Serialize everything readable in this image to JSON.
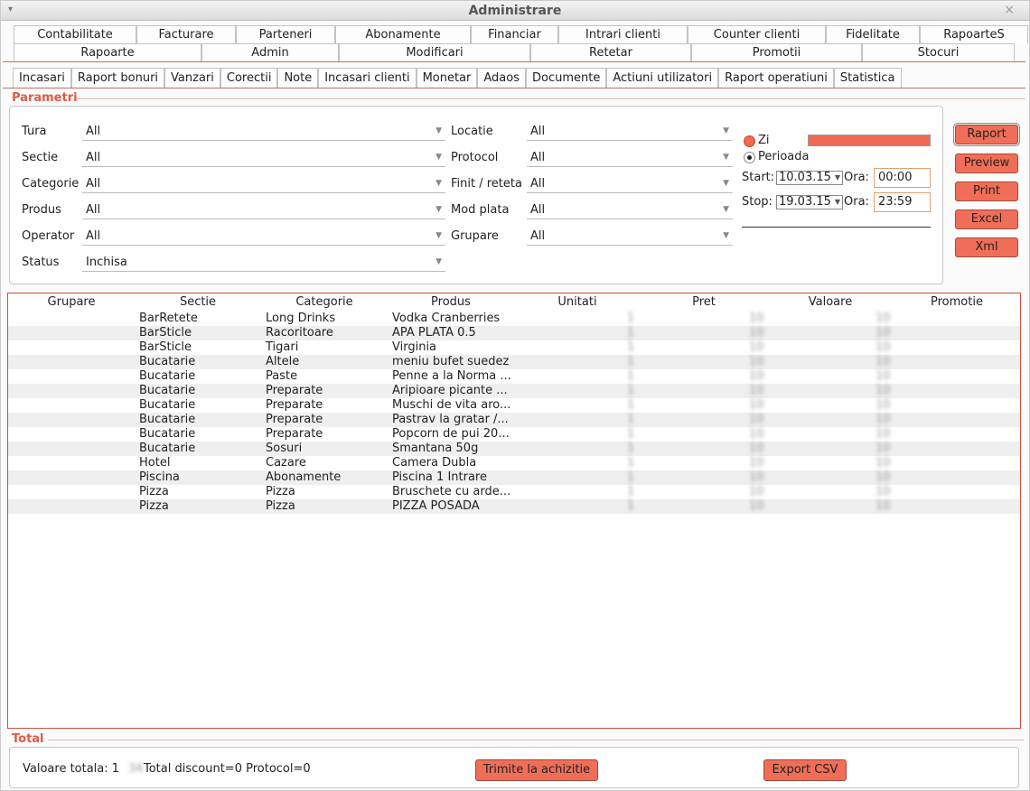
{
  "window": {
    "title": "Administrare",
    "close_glyph": "×",
    "menu_glyph": "▾"
  },
  "tabs_row1": [
    "Contabilitate",
    "Facturare",
    "Parteneri",
    "Abonamente",
    "Financiar",
    "Intrari clienti",
    "Counter clienti",
    "Fidelitate",
    "RapoarteS"
  ],
  "tabs_row2": [
    "Rapoarte",
    "Admin",
    "Modificari",
    "Retetar",
    "Promotii",
    "Stocuri"
  ],
  "subtabs": [
    "Incasari",
    "Raport bonuri",
    "Vanzari",
    "Corectii",
    "Note",
    "Incasari clienti",
    "Monetar",
    "Adaos",
    "Documente",
    "Actiuni utilizatori",
    "Raport operatiuni",
    "Statistica"
  ],
  "params": {
    "section_label": "Parametri",
    "left": [
      {
        "label": "Tura",
        "value": "All"
      },
      {
        "label": "Sectie",
        "value": "All"
      },
      {
        "label": "Categorie",
        "value": "All"
      },
      {
        "label": "Produs",
        "value": "All"
      },
      {
        "label": "Operator",
        "value": "All"
      },
      {
        "label": "Status",
        "value": "Inchisa"
      }
    ],
    "middle": [
      {
        "label": "Locatie",
        "value": "All"
      },
      {
        "label": "Protocol",
        "value": "All"
      },
      {
        "label": "Finit / reteta",
        "value": "All"
      },
      {
        "label": "Mod plata",
        "value": "All"
      },
      {
        "label": "Grupare",
        "value": "All"
      }
    ],
    "period": {
      "zi_label": "Zi",
      "perioada_label": "Perioada",
      "start_label": "Start:",
      "start_date": "10.03.15",
      "stop_label": "Stop:",
      "stop_date": "19.03.15",
      "ora_label": "Ora:",
      "start_time": "00:00",
      "stop_time": "23:59"
    },
    "buttons": [
      "Raport",
      "Preview",
      "Print",
      "Excel",
      "Xml"
    ]
  },
  "grid": {
    "columns": [
      "Grupare",
      "Sectie",
      "Categorie",
      "Produs",
      "Unitati",
      "Pret",
      "Valoare",
      "Promotie"
    ],
    "rows": [
      {
        "sectie": "BarRetete",
        "categorie": "Long Drinks",
        "produs": "Vodka Cranberries"
      },
      {
        "sectie": "BarSticle",
        "categorie": "Racoritoare",
        "produs": "APA PLATA 0.5"
      },
      {
        "sectie": "BarSticle",
        "categorie": "Tigari",
        "produs": "Virginia"
      },
      {
        "sectie": "Bucatarie",
        "categorie": "Altele",
        "produs": "meniu bufet suedez"
      },
      {
        "sectie": "Bucatarie",
        "categorie": "Paste",
        "produs": "Penne a la Norma ..."
      },
      {
        "sectie": "Bucatarie",
        "categorie": "Preparate",
        "produs": "Aripioare picante ..."
      },
      {
        "sectie": "Bucatarie",
        "categorie": "Preparate",
        "produs": "Muschi de vita aro..."
      },
      {
        "sectie": "Bucatarie",
        "categorie": "Preparate",
        "produs": "Pastrav la gratar /..."
      },
      {
        "sectie": "Bucatarie",
        "categorie": "Preparate",
        "produs": "Popcorn de pui 20..."
      },
      {
        "sectie": "Bucatarie",
        "categorie": "Sosuri",
        "produs": "Smantana 50g"
      },
      {
        "sectie": "Hotel",
        "categorie": "Cazare",
        "produs": "Camera Dubla"
      },
      {
        "sectie": "Piscina",
        "categorie": "Abonamente",
        "produs": "Piscina 1 Intrare"
      },
      {
        "sectie": "Pizza",
        "categorie": "Pizza",
        "produs": "Bruschete cu arde..."
      },
      {
        "sectie": "Pizza",
        "categorie": "Pizza",
        "produs": "PIZZA POSADA"
      }
    ]
  },
  "total": {
    "section_label": "Total",
    "summary_prefix": "Valoare totala: 1",
    "summary_suffix": "Total discount=0 Protocol=0",
    "send_button": "Trimite la achizitie",
    "export_button": "Export CSV"
  },
  "colors": {
    "accent": "#f06e58",
    "label_red": "#e05a45",
    "grid_border": "#c9503a"
  }
}
